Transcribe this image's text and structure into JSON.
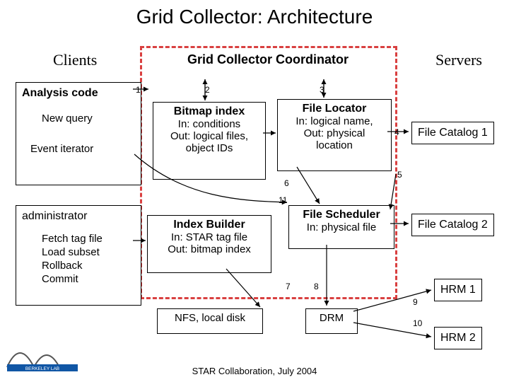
{
  "title": "Grid Collector: Architecture",
  "sections": {
    "clients": "Clients",
    "servers": "Servers",
    "coordinator": "Grid Collector Coordinator"
  },
  "client1": {
    "heading": "Analysis code",
    "sub1": "New query",
    "sub2": "Event iterator"
  },
  "client2": {
    "heading": "administrator",
    "sub1": "Fetch tag file",
    "sub2": "Load subset",
    "sub3": "Rollback",
    "sub4": "Commit"
  },
  "components": {
    "bitmap": {
      "title": "Bitmap index",
      "l1": "In: conditions",
      "l2": "Out: logical files,",
      "l3": "object IDs"
    },
    "locator": {
      "title": "File Locator",
      "l1": "In: logical name,",
      "l2": "Out: physical",
      "l3": "location"
    },
    "builder": {
      "title": "Index Builder",
      "l1": "In: STAR tag file",
      "l2": "Out: bitmap index"
    },
    "scheduler": {
      "title": "File Scheduler",
      "l1": "In: physical file"
    },
    "nfs": "NFS, local disk",
    "drm": "DRM"
  },
  "servers": {
    "fc1": "File Catalog 1",
    "fc2": "File Catalog 2",
    "hrm1": "HRM 1",
    "hrm2": "HRM 2"
  },
  "nums": {
    "n1": "1",
    "n2": "2",
    "n3": "3",
    "n4": "4",
    "n5": "5",
    "n6": "6",
    "n7": "7",
    "n8": "8",
    "n9": "9",
    "n10": "10",
    "n11": "11"
  },
  "footer": "STAR Collaboration, July 2004"
}
